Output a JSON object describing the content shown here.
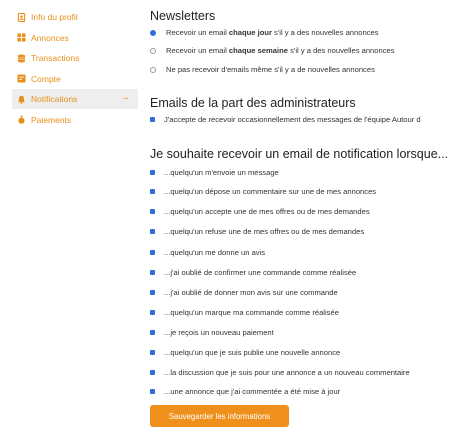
{
  "sidebar": {
    "items": [
      {
        "label": "Info du profil",
        "icon": "profile-icon"
      },
      {
        "label": "Annonces",
        "icon": "grid-icon"
      },
      {
        "label": "Transactions",
        "icon": "coins-icon"
      },
      {
        "label": "Compte",
        "icon": "account-icon"
      },
      {
        "label": "Notifications",
        "icon": "bell-icon",
        "active": true
      },
      {
        "label": "Paiements",
        "icon": "money-bag-icon"
      }
    ],
    "active_arrow": "→"
  },
  "newsletters": {
    "title": "Newsletters",
    "options": [
      {
        "prefix": "Recevoir un email ",
        "bold": "chaque jour",
        "suffix": " s'il y a des nouvelles annonces",
        "selected": true
      },
      {
        "prefix": "Recevoir un email ",
        "bold": "chaque semaine",
        "suffix": " s'il y a des nouvelles annonces",
        "selected": false
      },
      {
        "prefix": "Ne pas recevoir d'emails même s'il y a de nouvelles annonces",
        "bold": "",
        "suffix": "",
        "selected": false
      }
    ]
  },
  "admin_emails": {
    "title": "Emails de la part des administrateurs",
    "checkbox_label": "J'accepte de recevoir occasionnellement des messages de l'équipe Autour d"
  },
  "notifications": {
    "title": "Je souhaite recevoir un email de notification lorsque...",
    "items": [
      "...quelqu'un m'envoie un message",
      "...quelqu'un dépose un commentaire sur une de mes annonces",
      "...quelqu'un accepte une de mes offres ou de mes demandes",
      "...quelqu'un refuse une de mes offres ou de mes demandes",
      "...quelqu'un me donne un avis",
      "...j'ai oublié de confirmer une commande comme réalisée",
      "...j'ai oublié de donner mon avis sur une commande",
      "...quelqu'un marque ma commande comme réalisée",
      "...je reçois un nouveau paiement",
      "...quelqu'un que je suis publie une nouvelle annonce",
      "...la discussion que je suis pour une annonce a un nouveau commentaire",
      "...une annonce que j'ai commentée a été mise à jour"
    ]
  },
  "save_button": {
    "label": "Sauvegarder les informations"
  },
  "colors": {
    "accent": "#f0901c",
    "checkbox": "#2f6fd8"
  }
}
